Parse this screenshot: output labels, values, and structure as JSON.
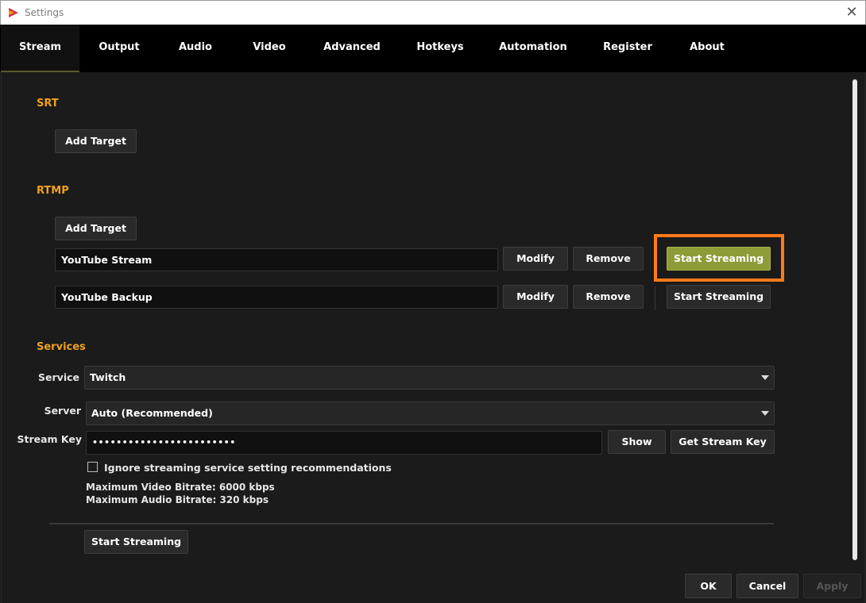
{
  "window": {
    "title": "Settings",
    "close_glyph": "✕",
    "app_icon": "app-logo-icon"
  },
  "tabs": [
    {
      "label": "Stream",
      "active": true
    },
    {
      "label": "Output"
    },
    {
      "label": "Audio"
    },
    {
      "label": "Video"
    },
    {
      "label": "Advanced"
    },
    {
      "label": "Hotkeys"
    },
    {
      "label": "Automation"
    },
    {
      "label": "Register"
    },
    {
      "label": "About"
    }
  ],
  "srt": {
    "heading": "SRT",
    "add_target": "Add Target"
  },
  "rtmp": {
    "heading": "RTMP",
    "add_target": "Add Target",
    "targets": [
      {
        "name": "YouTube Stream",
        "modify": "Modify",
        "remove": "Remove",
        "start": "Start Streaming",
        "highlighted": true
      },
      {
        "name": "YouTube Backup",
        "modify": "Modify",
        "remove": "Remove",
        "start": "Start Streaming"
      }
    ]
  },
  "services": {
    "heading": "Services",
    "service_label": "Service",
    "service_value": "Twitch",
    "server_label": "Server",
    "server_value": "Auto (Recommended)",
    "stream_key_label": "Stream Key",
    "stream_key_value": "••••••••••••••••••••••••",
    "show_button": "Show",
    "get_key_button": "Get Stream Key",
    "ignore_checkbox_label": "Ignore streaming service setting recommendations",
    "ignore_checked": false,
    "max_video": "Maximum Video Bitrate: 6000 kbps",
    "max_audio": "Maximum Audio Bitrate: 320 kbps",
    "start_streaming": "Start Streaming"
  },
  "footer": {
    "ok": "OK",
    "cancel": "Cancel",
    "apply": "Apply"
  },
  "colors": {
    "accent_orange": "#f0a020",
    "highlight_orange": "#ff7a1a",
    "start_green": "#8f9b36"
  }
}
